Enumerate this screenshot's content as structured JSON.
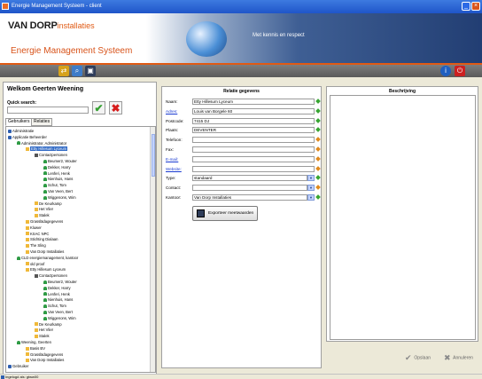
{
  "window": {
    "title": "Energie Management Systeem - client",
    "min_label": "_",
    "close_label": "×"
  },
  "banner": {
    "logo_main": "VAN DORP",
    "logo_sub": "installaties",
    "system_name": "Energie Management Systeem",
    "slogan": "Met kennis en respect"
  },
  "toolbar": {
    "left_icons": [
      "refresh-icon",
      "search-icon",
      "save-icon"
    ],
    "right_icons": [
      "info-icon",
      "power-icon"
    ]
  },
  "left": {
    "welcome": "Welkom Geerten Weening",
    "quick_search_label": "Quick search:",
    "quick_search_value": "",
    "tabs": [
      "Gebruikers",
      "Relaties"
    ],
    "tree": [
      {
        "text": "Administratie",
        "depth": 0,
        "icon": "admin"
      },
      {
        "text": "Applicatie Beheerder",
        "depth": 0,
        "icon": "admin"
      },
      {
        "text": "Administrator, Administrator",
        "depth": 1,
        "icon": "person"
      },
      {
        "text": "Etty Hillesum Lyceum",
        "depth": 2,
        "icon": "folder",
        "selected": true
      },
      {
        "text": "Contactpersonen",
        "depth": 3,
        "icon": "cont"
      },
      {
        "text": "Beumer2, Wouter",
        "depth": 4,
        "icon": "person"
      },
      {
        "text": "Dekker, Harry",
        "depth": 4,
        "icon": "person"
      },
      {
        "text": "Lenferi, Henk",
        "depth": 4,
        "icon": "person"
      },
      {
        "text": "Nienhuis, Hans",
        "depth": 4,
        "icon": "person"
      },
      {
        "text": "Schut, Tom",
        "depth": 4,
        "icon": "person"
      },
      {
        "text": "Van Veen, Bert",
        "depth": 4,
        "icon": "person"
      },
      {
        "text": "Wiggenons, Wim",
        "depth": 4,
        "icon": "person"
      },
      {
        "text": "De Keurkamp",
        "depth": 3,
        "icon": "folder"
      },
      {
        "text": "Het Vlier",
        "depth": 3,
        "icon": "folder"
      },
      {
        "text": "Stalek",
        "depth": 3,
        "icon": "folder"
      },
      {
        "text": "Grasslädagegevens",
        "depth": 2,
        "icon": "folder"
      },
      {
        "text": "Kluwer",
        "depth": 2,
        "icon": "folder"
      },
      {
        "text": "KSAC NPC",
        "depth": 2,
        "icon": "folder"
      },
      {
        "text": "Stichting Dialaan",
        "depth": 2,
        "icon": "folder"
      },
      {
        "text": "The Sling",
        "depth": 2,
        "icon": "folder"
      },
      {
        "text": "Van Dorp Installaties",
        "depth": 2,
        "icon": "folder"
      },
      {
        "text": "CLD energiemanagement, kantoor",
        "depth": 1,
        "icon": "person"
      },
      {
        "text": "old proof",
        "depth": 2,
        "icon": "folder"
      },
      {
        "text": "Etty Hillesum Lyceum",
        "depth": 2,
        "icon": "folder"
      },
      {
        "text": "Contactpersonen",
        "depth": 3,
        "icon": "cont"
      },
      {
        "text": "Beumer2, Wouter",
        "depth": 4,
        "icon": "person"
      },
      {
        "text": "Dekker, Harry",
        "depth": 4,
        "icon": "person"
      },
      {
        "text": "Lenferi, Henk",
        "depth": 4,
        "icon": "person"
      },
      {
        "text": "Nienhuis, Hans",
        "depth": 4,
        "icon": "person"
      },
      {
        "text": "Schut, Tom",
        "depth": 4,
        "icon": "person"
      },
      {
        "text": "Van Veen, Bert",
        "depth": 4,
        "icon": "person"
      },
      {
        "text": "Wiggenons, Wim",
        "depth": 4,
        "icon": "person"
      },
      {
        "text": "De Keurkamp",
        "depth": 3,
        "icon": "folder"
      },
      {
        "text": "Het Vlier",
        "depth": 3,
        "icon": "folder"
      },
      {
        "text": "Stalek",
        "depth": 3,
        "icon": "folder"
      },
      {
        "text": "Weening, Geerten",
        "depth": 1,
        "icon": "person"
      },
      {
        "text": "Basis BV",
        "depth": 2,
        "icon": "folder"
      },
      {
        "text": "Grasslädagegevens",
        "depth": 2,
        "icon": "folder"
      },
      {
        "text": "Van Dorp Installaties",
        "depth": 2,
        "icon": "folder"
      },
      {
        "text": "Gebruiker",
        "depth": 0,
        "icon": "admin"
      }
    ]
  },
  "relation": {
    "heading": "Relatie gegevens",
    "fields": [
      {
        "label": "Naam:",
        "value": "Etty Hillesum Lyceum",
        "link": false,
        "combo": false,
        "status": "#38a633"
      },
      {
        "label": "Adres:",
        "value": "Louis van Borgele 60",
        "link": true,
        "combo": false,
        "status": "#38a633"
      },
      {
        "label": "Postcode:",
        "value": "7415 DJ",
        "link": false,
        "combo": false,
        "status": "#38a633"
      },
      {
        "label": "Plaats:",
        "value": "DEVENTER",
        "link": false,
        "combo": false,
        "status": "#38a633"
      },
      {
        "label": "Telefoon:",
        "value": "",
        "link": false,
        "combo": false,
        "status": "#e08a1e"
      },
      {
        "label": "Fax:",
        "value": "",
        "link": false,
        "combo": false,
        "status": "#e08a1e"
      },
      {
        "label": "E-mail:",
        "value": "",
        "link": true,
        "combo": false,
        "status": "#e08a1e"
      },
      {
        "label": "Website:",
        "value": "",
        "link": true,
        "combo": false,
        "status": "#e08a1e"
      },
      {
        "label": "Type:",
        "value": "standaard",
        "link": false,
        "combo": true,
        "status": "#38a633"
      },
      {
        "label": "Contact:",
        "value": "",
        "link": false,
        "combo": true,
        "status": "#e08a1e"
      },
      {
        "label": "Kantoor:",
        "value": "Van Dorp Installaties",
        "link": false,
        "combo": true,
        "status": "#38a633"
      }
    ],
    "export_label": "Exporteer meetwaarden"
  },
  "description": {
    "heading": "Beschrijving",
    "value": ""
  },
  "actions": {
    "save_label": "Opslaan",
    "cancel_label": "Annuleren"
  },
  "status": {
    "text": "Ingelogd als: gtww00"
  }
}
